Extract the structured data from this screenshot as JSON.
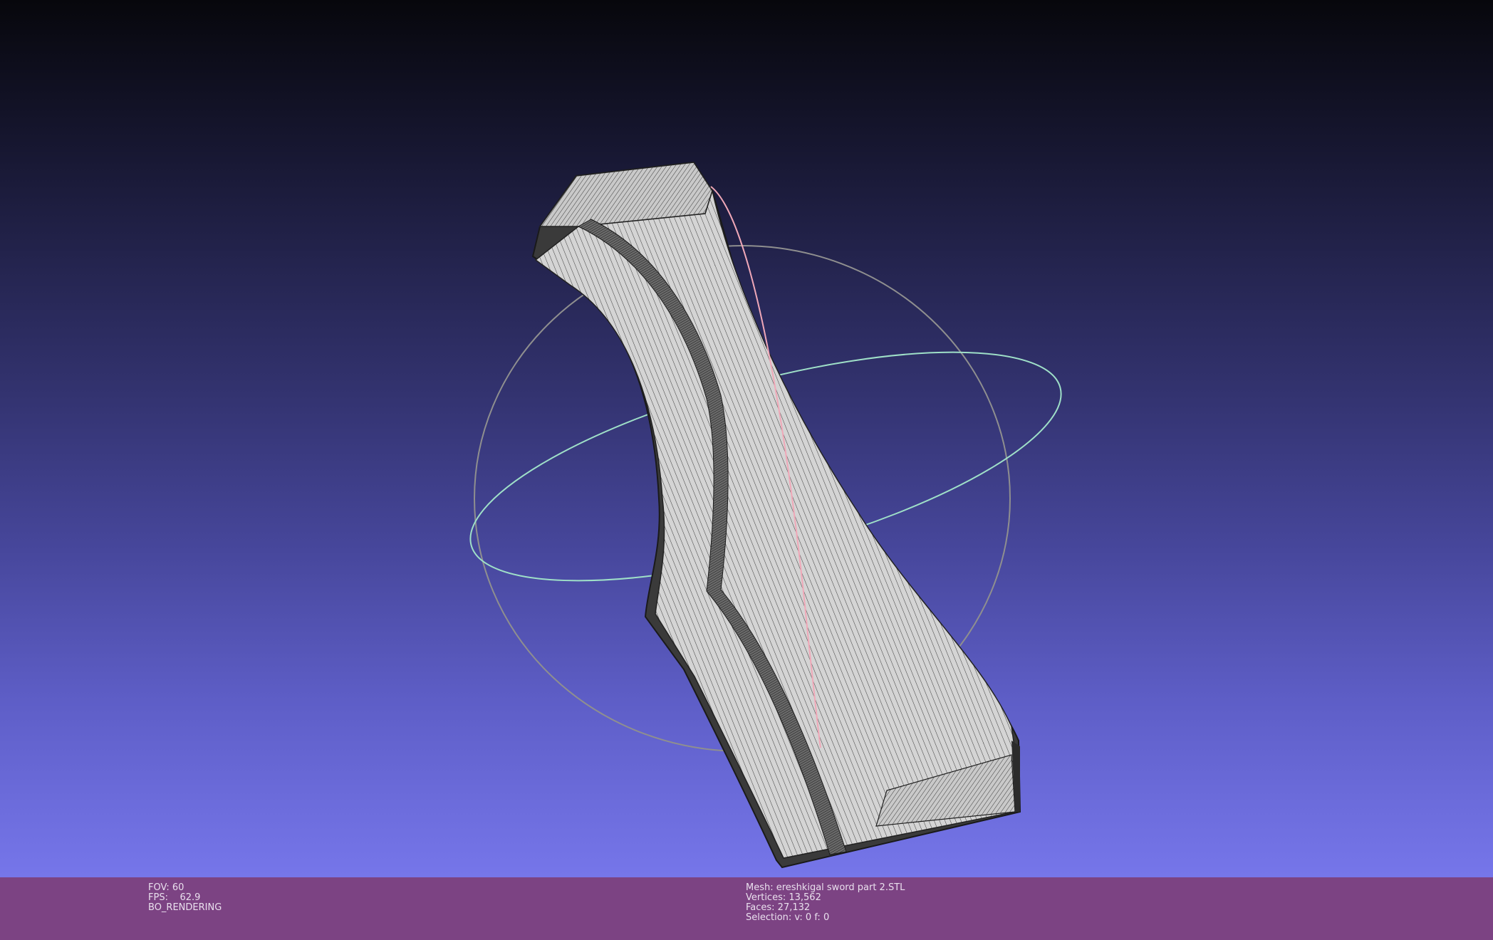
{
  "window": {
    "title": "MeshLab 3D viewport"
  },
  "viewport": {
    "background_top": "#07070c",
    "background_bottom": "#7676ea",
    "mesh_color": "#d2d2d2",
    "wire_color": "#1e1e1e",
    "trackball": {
      "vertical_ring_color": "#8f8f8f",
      "horizontal_ring_color": "#9fe0c8",
      "meridian_color": "#f0a8b8"
    }
  },
  "status_bar": {
    "background": "#7c4383",
    "render_info": {
      "fov": "FOV: 60",
      "fps": "FPS:    62.9",
      "mode": "BO_RENDERING"
    },
    "mesh_info": {
      "mesh": "Mesh: ereshkigal sword part 2.STL",
      "vertices": "Vertices: 13,562",
      "faces": "Faces: 27,132",
      "selection": "Selection: v: 0 f: 0"
    }
  }
}
